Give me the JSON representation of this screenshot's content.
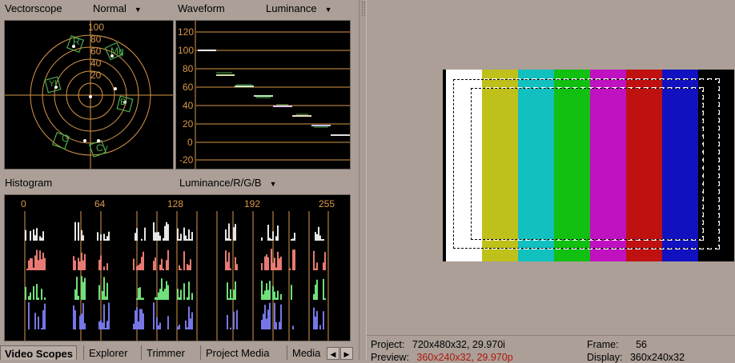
{
  "vectorscope": {
    "title": "Vectorscope",
    "mode": "Normal",
    "ring_labels": [
      "100",
      "80",
      "60",
      "40",
      "20"
    ],
    "targets": [
      "R",
      "Mg",
      "B",
      "Cy",
      "G",
      "Yl"
    ]
  },
  "waveform": {
    "title": "Waveform",
    "mode": "Luminance",
    "levels": [
      "120",
      "100",
      "80",
      "60",
      "40",
      "20",
      "0",
      "-20"
    ]
  },
  "histogram": {
    "title": "Histogram",
    "mode": "Luminance/R/G/B",
    "ticks": [
      "0",
      "64",
      "128",
      "192",
      "255"
    ],
    "channel_colors": [
      "#e6e6e6",
      "#e87a73",
      "#6fe07a",
      "#7676e6"
    ]
  },
  "tabs": [
    "Video Scopes",
    "Explorer",
    "Trimmer",
    "Project Media",
    "Media"
  ],
  "preview": {
    "bar_colors": [
      "#ffffff",
      "#c0c01a",
      "#12c0c0",
      "#11c011",
      "#c011c0",
      "#c01111",
      "#1111c0",
      "#000000"
    ]
  },
  "status": {
    "project_label": "Project:",
    "project_value": "720x480x32, 29.970i",
    "preview_label": "Preview:",
    "preview_value": "360x240x32, 29.970p",
    "frame_label": "Frame:",
    "frame_value": "56",
    "display_label": "Display:",
    "display_value": "360x240x32"
  }
}
